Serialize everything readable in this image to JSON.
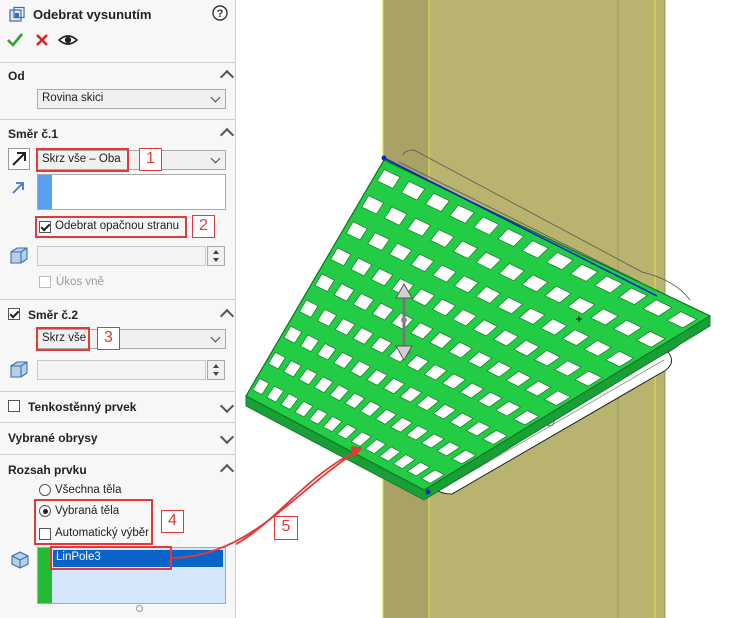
{
  "panel": {
    "title": "Odebrat vysunutím",
    "help_icon": "help-icon",
    "actions": {
      "ok_icon": "check-icon",
      "cancel_icon": "close-icon",
      "preview_icon": "eye-icon"
    },
    "from": {
      "heading": "Od",
      "value": "Rovina skici"
    },
    "direction1": {
      "heading": "Směr č.1",
      "end_condition": "Skrz vše – Oba",
      "flip_side_label": "Odebrat opačnou stranu",
      "flip_side_checked": true,
      "draft_label": "Úkos vně",
      "draft_checked": false
    },
    "direction2": {
      "heading": "Směr č.2",
      "enabled": true,
      "end_condition": "Skrz vše"
    },
    "thin_feature": {
      "heading": "Tenkostěnný prvek",
      "checked": false
    },
    "selected_contours": {
      "heading": "Vybrané obrysy"
    },
    "feature_scope": {
      "heading": "Rozsah prvku",
      "options": [
        "Všechna těla",
        "Vybraná těla"
      ],
      "selected_option": "Vybraná těla",
      "auto_select_label": "Automatický výběr",
      "auto_select_checked": false,
      "bodies": [
        "LinPole3"
      ]
    }
  },
  "callouts": [
    "1",
    "2",
    "3",
    "4",
    "5"
  ],
  "colors": {
    "accent_red": "#e03a3a",
    "grid_green": "#22cc44",
    "wall_olive": "#b8b36e",
    "selection_blue": "#0a64c8"
  }
}
